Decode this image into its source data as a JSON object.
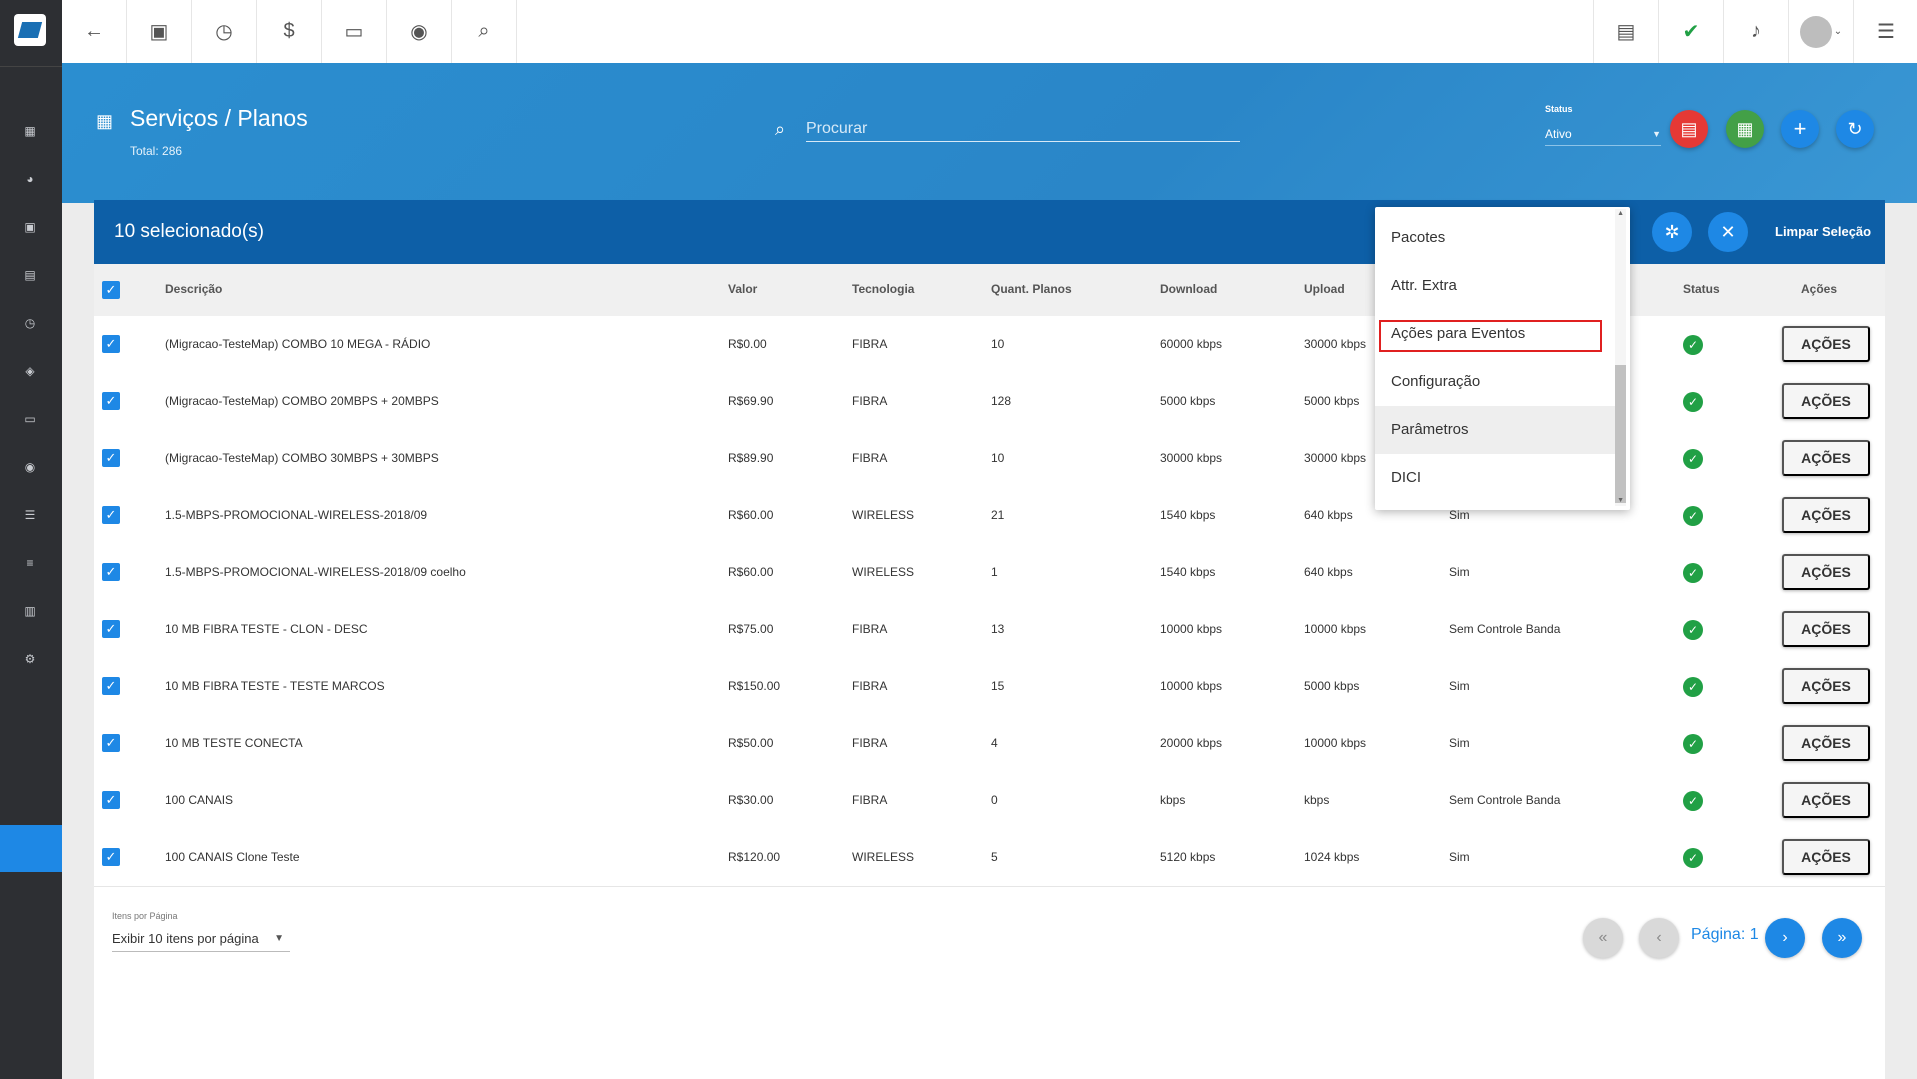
{
  "topbar": {
    "left_icons": [
      "back-arrow-icon",
      "contact-card-icon",
      "calendar-clock-icon",
      "dollar-icon",
      "terminal-icon",
      "eye-icon",
      "search-icon"
    ],
    "right_icons": [
      "pdf-icon",
      "chat-check-icon",
      "bell-icon",
      "avatar",
      "menu-icon"
    ]
  },
  "page": {
    "title": "Serviços / Planos",
    "total": "Total: 286",
    "search_placeholder": "Procurar",
    "status_label": "Status",
    "status_value": "Ativo"
  },
  "selection": {
    "count": "10 selecionado(s)",
    "clear": "Limpar Seleção"
  },
  "columns": [
    "Descrição",
    "Valor",
    "Tecnologia",
    "Quant. Planos",
    "Download",
    "Upload",
    "Status",
    "Ações"
  ],
  "rows": [
    {
      "desc": "(Migracao-TesteMap) COMBO 10 MEGA - RÁDIO",
      "valor": "R$0.00",
      "tec": "FIBRA",
      "qtd": "10",
      "down": "60000 kbps",
      "up": "30000 kbps",
      "ctrl": ""
    },
    {
      "desc": "(Migracao-TesteMap) COMBO 20MBPS + 20MBPS",
      "valor": "R$69.90",
      "tec": "FIBRA",
      "qtd": "128",
      "down": "5000 kbps",
      "up": "5000 kbps",
      "ctrl": ""
    },
    {
      "desc": "(Migracao-TesteMap) COMBO 30MBPS + 30MBPS",
      "valor": "R$89.90",
      "tec": "FIBRA",
      "qtd": "10",
      "down": "30000 kbps",
      "up": "30000 kbps",
      "ctrl": ""
    },
    {
      "desc": "1.5-MBPS-PROMOCIONAL-WIRELESS-2018/09",
      "valor": "R$60.00",
      "tec": "WIRELESS",
      "qtd": "21",
      "down": "1540 kbps",
      "up": "640 kbps",
      "ctrl": "Sim"
    },
    {
      "desc": "1.5-MBPS-PROMOCIONAL-WIRELESS-2018/09 coelho",
      "valor": "R$60.00",
      "tec": "WIRELESS",
      "qtd": "1",
      "down": "1540 kbps",
      "up": "640 kbps",
      "ctrl": "Sim"
    },
    {
      "desc": "10 MB FIBRA TESTE - CLON - DESC",
      "valor": "R$75.00",
      "tec": "FIBRA",
      "qtd": "13",
      "down": "10000 kbps",
      "up": "10000 kbps",
      "ctrl": "Sem Controle Banda"
    },
    {
      "desc": "10 MB FIBRA TESTE - TESTE MARCOS",
      "valor": "R$150.00",
      "tec": "FIBRA",
      "qtd": "15",
      "down": "10000 kbps",
      "up": "5000 kbps",
      "ctrl": "Sim"
    },
    {
      "desc": "10 MB TESTE CONECTA",
      "valor": "R$50.00",
      "tec": "FIBRA",
      "qtd": "4",
      "down": "20000 kbps",
      "up": "10000 kbps",
      "ctrl": "Sim"
    },
    {
      "desc": "100 CANAIS",
      "valor": "R$30.00",
      "tec": "FIBRA",
      "qtd": "0",
      "down": "kbps",
      "up": "kbps",
      "ctrl": "Sem Controle Banda"
    },
    {
      "desc": "100 CANAIS Clone Teste",
      "valor": "R$120.00",
      "tec": "WIRELESS",
      "qtd": "5",
      "down": "5120 kbps",
      "up": "1024 kbps",
      "ctrl": "Sim"
    }
  ],
  "row_action_label": "AÇÕES",
  "dropdown": {
    "items": [
      "Pacotes",
      "Attr. Extra",
      "Ações para Eventos",
      "Configuração",
      "Parâmetros",
      "DICI"
    ],
    "highlighted": "Ações para Eventos",
    "hovered": "Parâmetros"
  },
  "footer": {
    "items_label": "Itens por Página",
    "items_value": "Exibir 10 itens por página",
    "page_text": "Página: 1"
  },
  "colors": {
    "primary": "#1e88e5",
    "header_blue": "#2a86c8",
    "selection_bar": "#0d5fa7",
    "success": "#21a045",
    "danger": "#e53935"
  }
}
